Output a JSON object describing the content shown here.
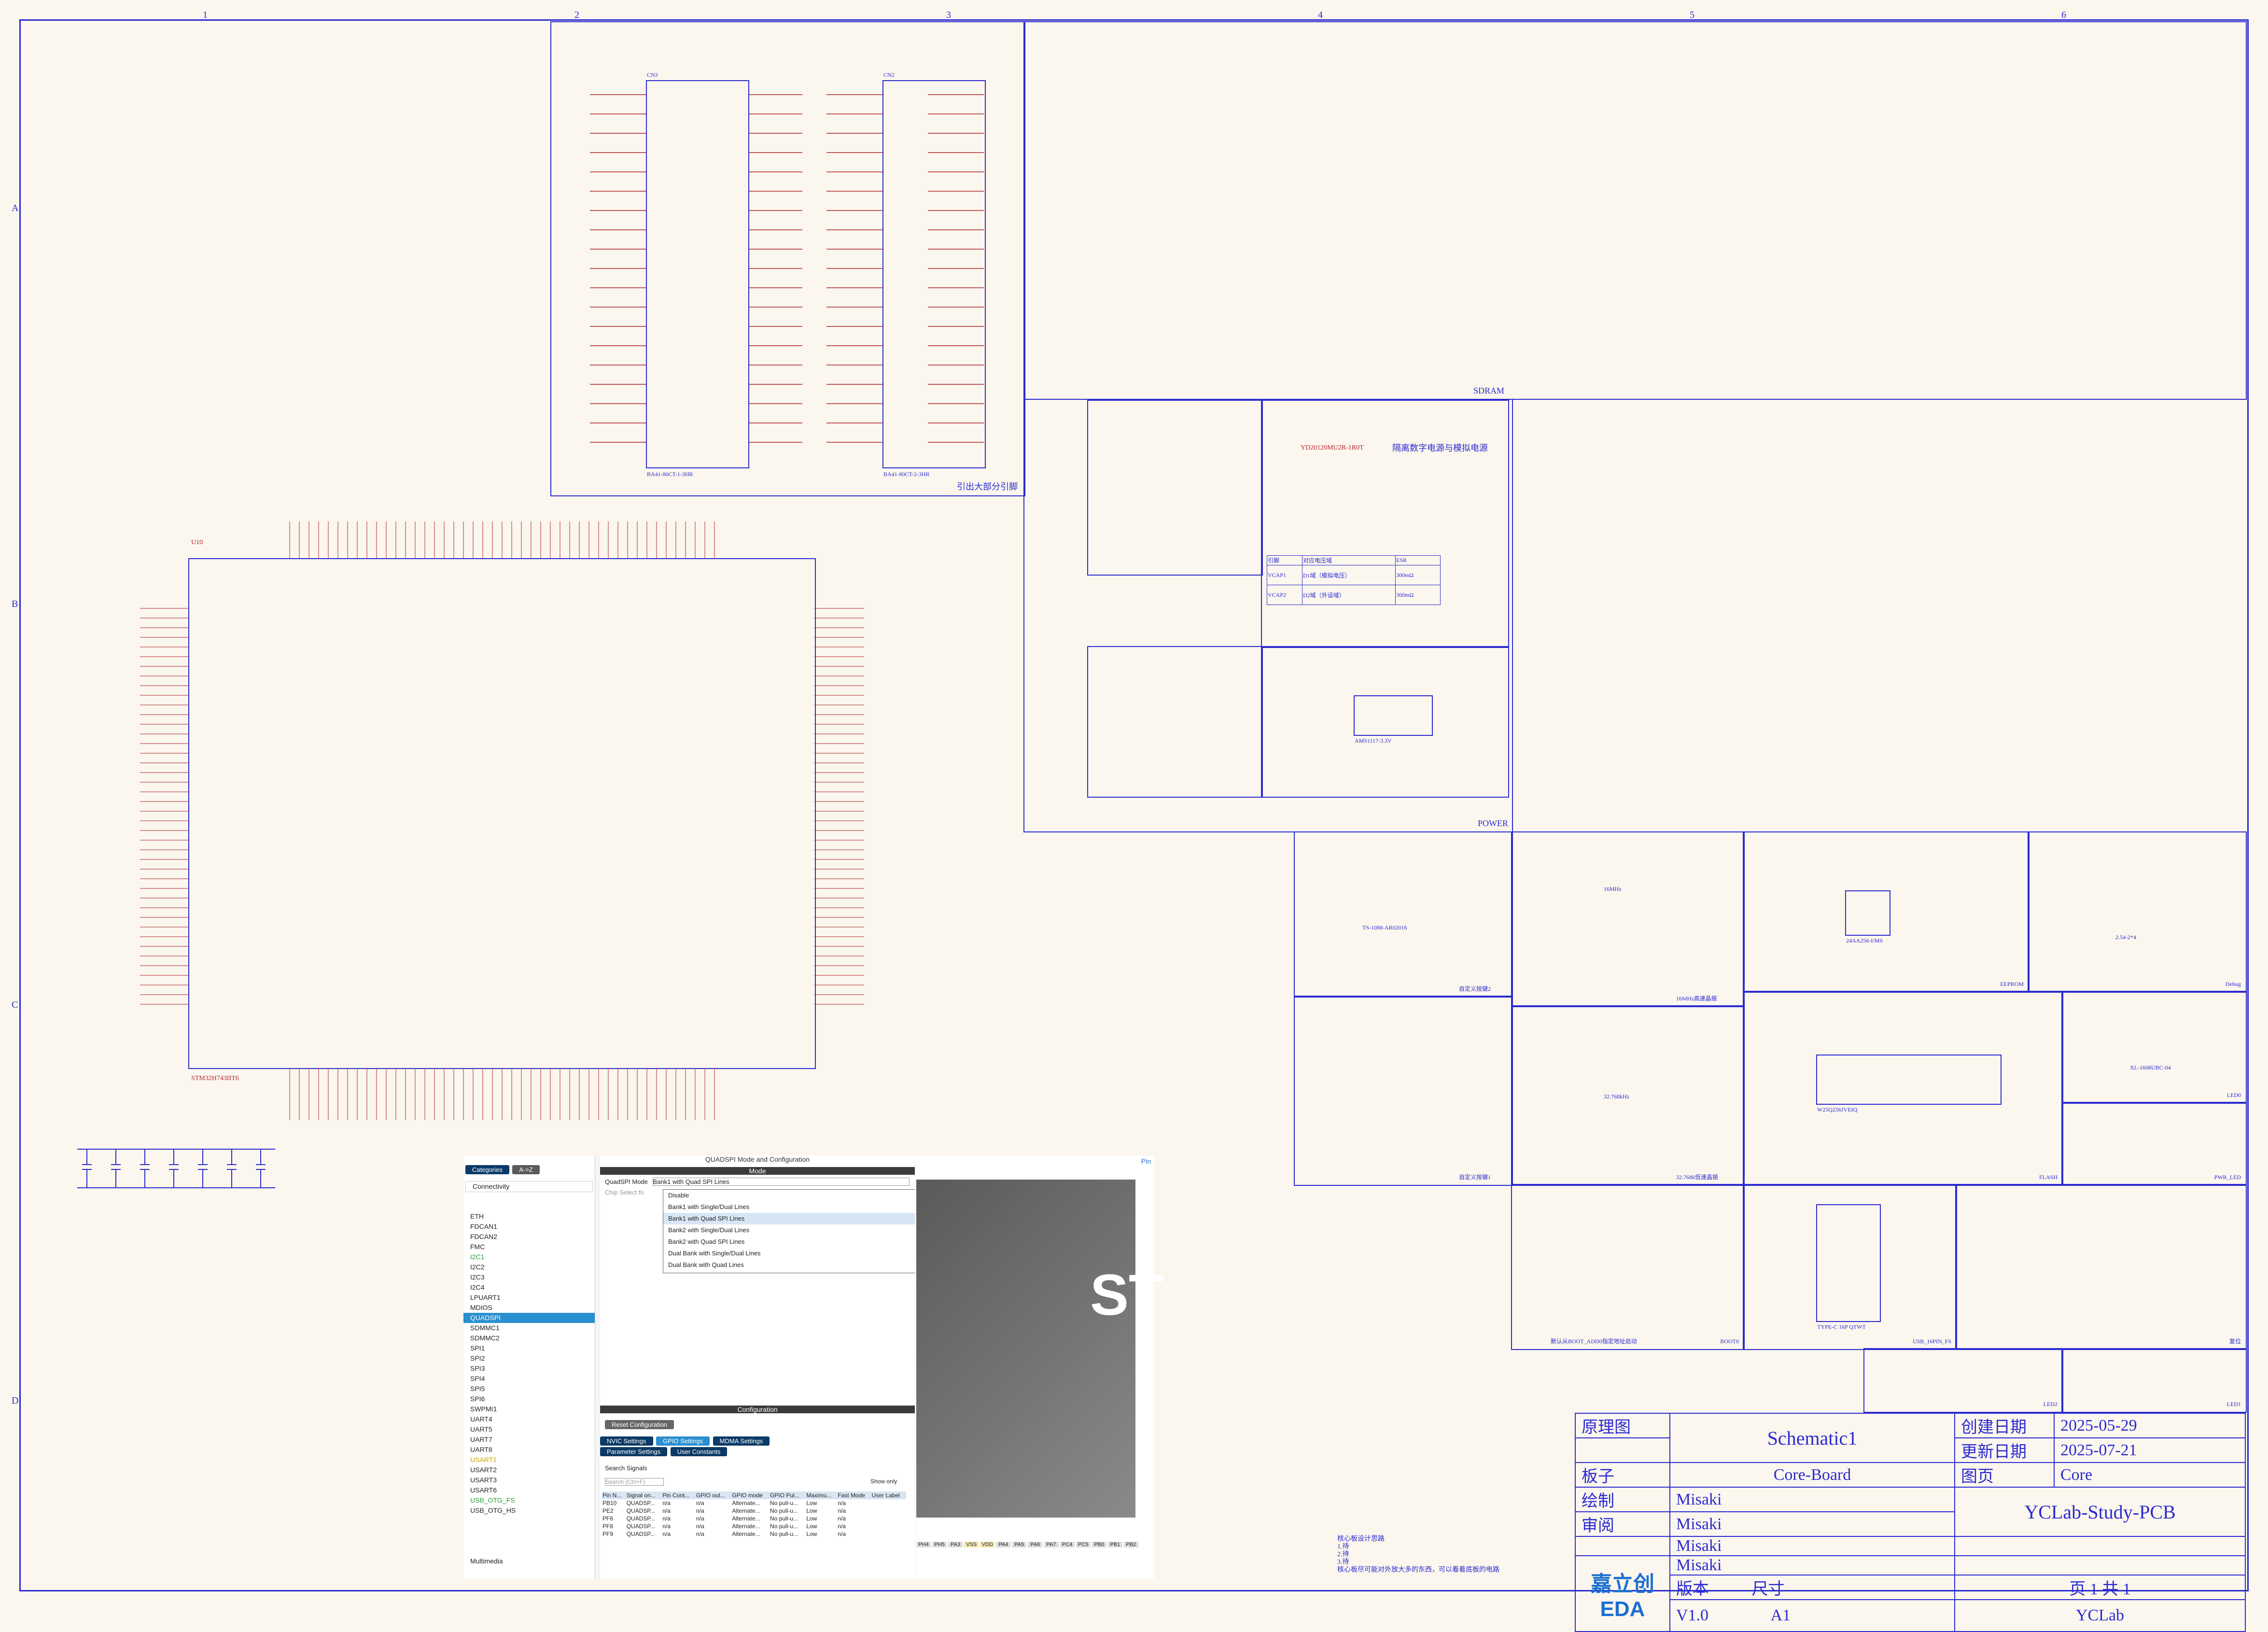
{
  "colors": {
    "wire": "#2b2bd0",
    "net": "#b0242a",
    "background": "#fbf6ee"
  },
  "ruler": {
    "columns": [
      "1",
      "2",
      "3",
      "4",
      "5",
      "6"
    ],
    "rows": [
      "A",
      "B",
      "C",
      "D"
    ]
  },
  "blocks": {
    "sdram": "SDRAM",
    "sdram_note": "引出大部分引脚",
    "cn3": "CN3",
    "cn2": "CN2",
    "cn3_part": "BA41-80CT-1-3HR",
    "cn2_part": "BA41-80CT-2-3HR",
    "power": "POWER",
    "power_note": "隔离数字电源与模拟电源",
    "power_table": {
      "headers": [
        "引脚",
        "对应电压域",
        "ESR"
      ],
      "rows": [
        [
          "VCAP1",
          "D1域（模拟电压）",
          "300mΩ"
        ],
        [
          "VCAP2",
          "D2域（外设域）",
          "300mΩ"
        ]
      ]
    },
    "ldo": "AMS1117-3.3V",
    "inductor": "YD20120MU2R-1R0T",
    "user2": "自定义按键2",
    "user1": "自定义按键1",
    "hse": "16MHz高速晶振",
    "lse": "32.768k低速晶振",
    "eeprom": "EEPROM",
    "eeprom_ic": "24AA256-I/MS",
    "debug": "Debug",
    "debug_part": "2.54-2*4",
    "flash": "FLASH",
    "flash_ic": "W25Q256JVEIQ",
    "led0": "LED0",
    "pwr_led": "PWR_LED",
    "led_part": "XL-1608UBC-04",
    "boot": "BOOT0",
    "boot_note": "默认从BOOT_ADD0指定地址启动",
    "usb": "USB_16PIN_FS",
    "usb_part": "TYPE-C 16P QTWT",
    "reset": "复位",
    "led2": "LED2",
    "led1": "LED1",
    "mcu": "U10",
    "mcu_part": "STM32H743IIT6",
    "button_part": "TS-1088-AR02016",
    "crystal_hse": "16MHz",
    "crystal_lse": "32.768kHz"
  },
  "notes": [
    "核心板设计思路",
    "1.待",
    "2.待",
    "3.待",
    "核心板尽可能对外放大多的东西，可以看着底板的电路"
  ],
  "title_block": {
    "l_schematic": "原理图",
    "schematic": "Schematic1",
    "l_created": "创建日期",
    "created": "2025-05-29",
    "l_updated": "更新日期",
    "updated": "2025-07-21",
    "l_board": "板子",
    "board": "Core-Board",
    "l_page": "图页",
    "page": "Core",
    "l_drawn": "绘制",
    "drawn": "Misaki",
    "l_review": "审阅",
    "review": "Misaki",
    "project": "YCLab-Study-PCB",
    "misaki3": "Misaki",
    "misaki4": "Misaki",
    "l_version": "版本",
    "l_size": "尺寸",
    "pages": "页 1 共 1",
    "version": "V1.0",
    "size": "A1",
    "company": "YCLab",
    "logo": "嘉立创EDA"
  },
  "cubemx": {
    "categories_tab": "Categories",
    "az_tab": "A->Z",
    "connectivity": "Connectivity",
    "items": [
      "ETH",
      "FDCAN1",
      "FDCAN2",
      "FMC",
      "I2C1",
      "I2C2",
      "I2C3",
      "I2C4",
      "LPUART1",
      "MDIOS",
      "QUADSPI",
      "SDMMC1",
      "SDMMC2",
      "SPI1",
      "SPI2",
      "SPI3",
      "SPI4",
      "SPI5",
      "SPI6",
      "SWPMI1",
      "UART4",
      "UART5",
      "UART7",
      "UART8",
      "USART1",
      "USART2",
      "USART3",
      "USART6",
      "USB_OTG_FS",
      "USB_OTG_HS"
    ],
    "multimedia": "Multimedia",
    "title": "QUADSPI Mode and Configuration",
    "mode": "Mode",
    "mode_label": "QuadSPI Mode",
    "mode_value": "Bank1 with Quad SPI Lines",
    "chip_select": "Chip Select fo",
    "options": [
      "Disable",
      "Bank1 with Single/Dual Lines",
      "Bank1 with Quad SPI Lines",
      "Bank2 with Single/Dual Lines",
      "Bank2 with Quad SPI Lines",
      "Dual Bank with Single/Dual Lines",
      "Dual Bank with Quad Lines"
    ],
    "configuration": "Configuration",
    "reset_config": "Reset Configuration",
    "tabs": [
      "NVIC Settings",
      "GPIO Settings",
      "MDMA Settings",
      "Parameter Settings",
      "User Constants"
    ],
    "search_signals": "Search Signals",
    "search_placeholder": "Search (Ctrl+F)",
    "show_only": "Show only",
    "columns": [
      "Pin N...",
      "Signal on...",
      "Pin Cont...",
      "GPIO out...",
      "GPIO mode",
      "GPIO Pul...",
      "Maximu...",
      "Fast Mode",
      "User Label"
    ],
    "rows": [
      [
        "PB10",
        "QUADSP...",
        "n/a",
        "n/a",
        "Alternate...",
        "No pull-u...",
        "Low",
        "n/a",
        ""
      ],
      [
        "PE2",
        "QUADSP...",
        "n/a",
        "n/a",
        "Alternate...",
        "No pull-u...",
        "Low",
        "n/a",
        ""
      ],
      [
        "PF6",
        "QUADSP...",
        "n/a",
        "n/a",
        "Alternate...",
        "No pull-u...",
        "Low",
        "n/a",
        ""
      ],
      [
        "PF8",
        "QUADSP...",
        "n/a",
        "n/a",
        "Alternate...",
        "No pull-u...",
        "Low",
        "n/a",
        ""
      ],
      [
        "PF9",
        "QUADSP...",
        "n/a",
        "n/a",
        "Alternate...",
        "No pull-u...",
        "Low",
        "n/a",
        ""
      ]
    ],
    "chip_text": "ST",
    "pins": [
      "PH4",
      "PH5",
      "PA3",
      "VSS",
      "VDD",
      "PA4",
      "PA5",
      "PA6",
      "PA7",
      "PC4",
      "PC5",
      "PB0",
      "PB1",
      "PB2"
    ],
    "pinout": "Pin"
  }
}
